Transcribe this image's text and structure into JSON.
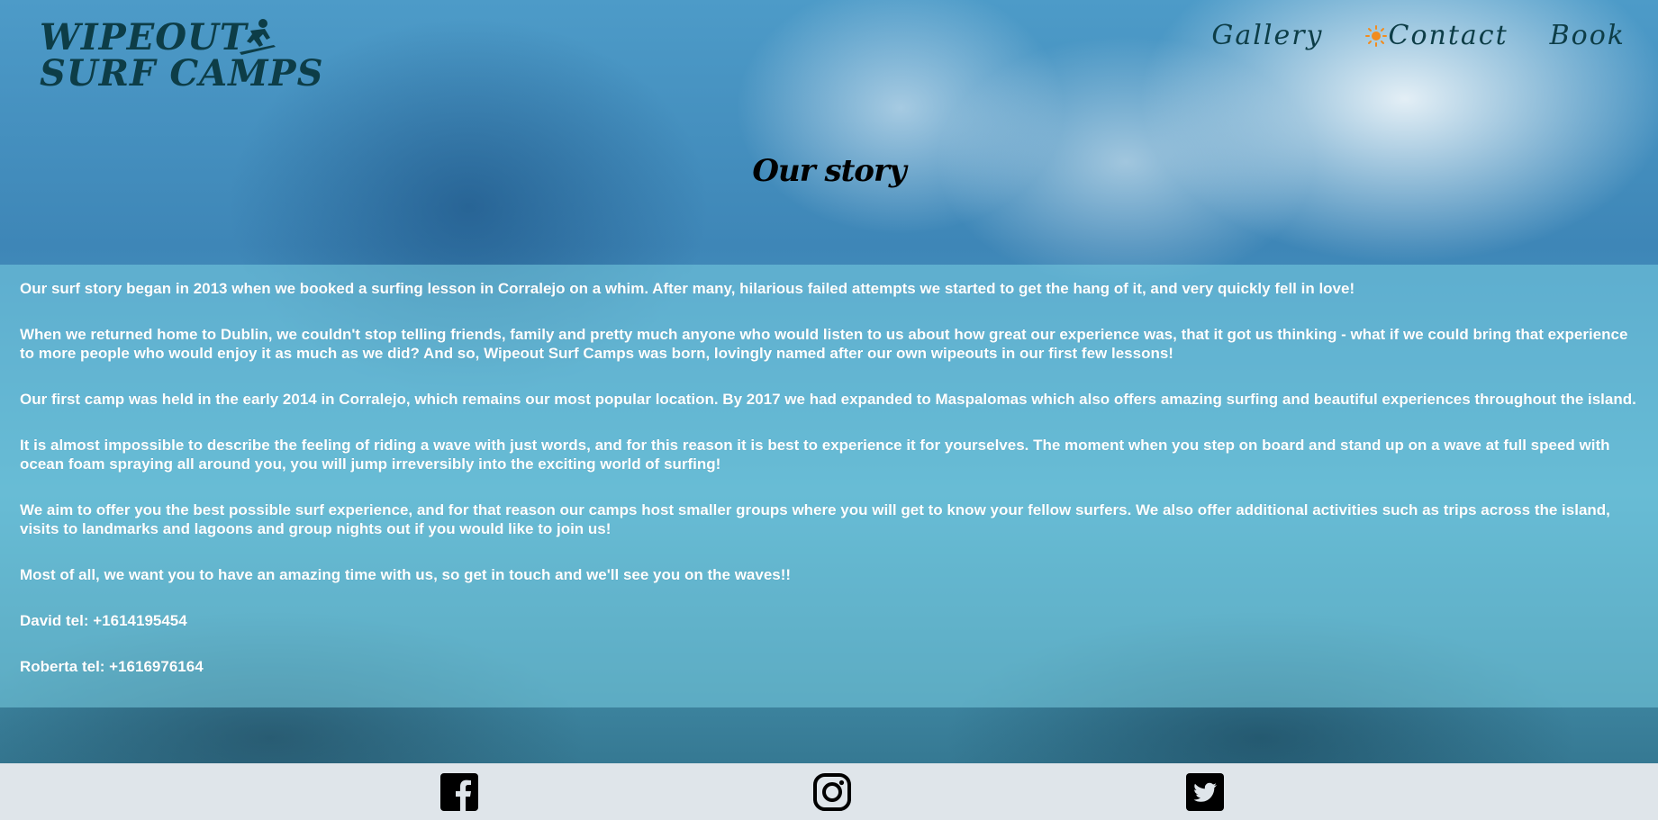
{
  "brand": {
    "line1": "WIPEOUT",
    "line2": "SURF CAMPS",
    "color": "#0d3d47"
  },
  "nav": {
    "items": [
      {
        "label": "Gallery"
      },
      {
        "label": "Contact",
        "icon": "sun-icon"
      },
      {
        "label": "Book"
      }
    ]
  },
  "page": {
    "title": "Our story"
  },
  "story": {
    "paragraphs": [
      "Our surf story began in 2013 when we booked a surfing lesson in Corralejo on a whim. After many, hilarious failed attempts we started to get the hang of it, and very quickly fell in love!",
      "When we returned home to Dublin, we couldn't stop telling friends, family and pretty much anyone who would listen to us about how great our experience was, that it got us thinking - what if we could bring that experience to more people who would enjoy it as much as we did? And so, Wipeout Surf Camps was born, lovingly named after our own wipeouts in our first few lessons!",
      "Our first camp was held in the early 2014 in Corralejo, which remains our most popular location. By 2017 we had expanded to Maspalomas which also offers amazing surfing and beautiful experiences throughout the island.",
      "It is almost impossible to describe the feeling of riding a wave with just words, and for this reason it is best to experience it for yourselves. The moment when you step on board and stand up on a wave at full speed with ocean foam spraying all around you, you will jump irreversibly into the exciting world of surfing!",
      "We aim to offer you the best possible surf experience, and for that reason our camps host smaller groups where you will get to know your fellow surfers. We also offer additional activities such as trips across the island, visits to landmarks and lagoons and group nights out if you would like to join us!",
      "Most of all, we want you to have an amazing time with us, so get in touch and we'll see you on the waves!!",
      "David tel: +1614195454",
      "Roberta tel: +1616976164"
    ]
  },
  "footer": {
    "icons": [
      "facebook-icon",
      "instagram-icon",
      "twitter-icon"
    ],
    "background": "#dfe5ea"
  }
}
